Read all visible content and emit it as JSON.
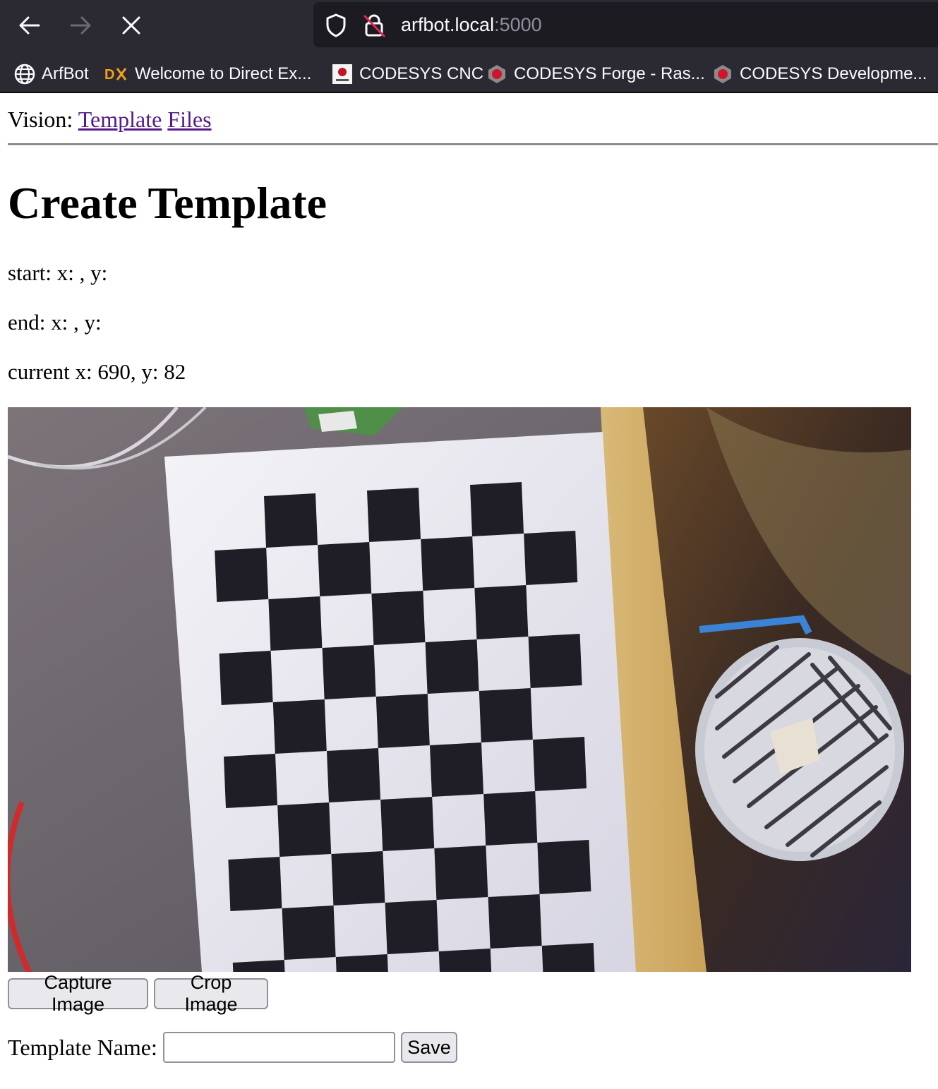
{
  "browser": {
    "url_host": "arfbot.local",
    "url_port": ":5000",
    "bookmarks": [
      {
        "label": "ArfBot",
        "icon": "globe-icon"
      },
      {
        "label": "Welcome to Direct Ex...",
        "icon": "dx-logo-icon"
      },
      {
        "label": "CODESYS CNC",
        "icon": "codesys-icon"
      },
      {
        "label": "CODESYS Forge - Ras...",
        "icon": "codesys-forge-icon"
      },
      {
        "label": "CODESYS Developme...",
        "icon": "codesys-forge-icon"
      }
    ]
  },
  "nav": {
    "prefix": "Vision:",
    "links": [
      "Template",
      "Files"
    ]
  },
  "page": {
    "title": "Create Template",
    "start": "start: x: , y:",
    "end": "end: x: , y:",
    "current": "current x: 690, y: 82"
  },
  "buttons": {
    "capture": "Capture Image",
    "crop": "Crop Image",
    "save": "Save"
  },
  "form": {
    "template_label": "Template Name:",
    "template_value": ""
  },
  "colors": {
    "chrome_bg": "#2b2a33",
    "url_bg": "#1c1b22",
    "link_visited": "#551a8b"
  }
}
